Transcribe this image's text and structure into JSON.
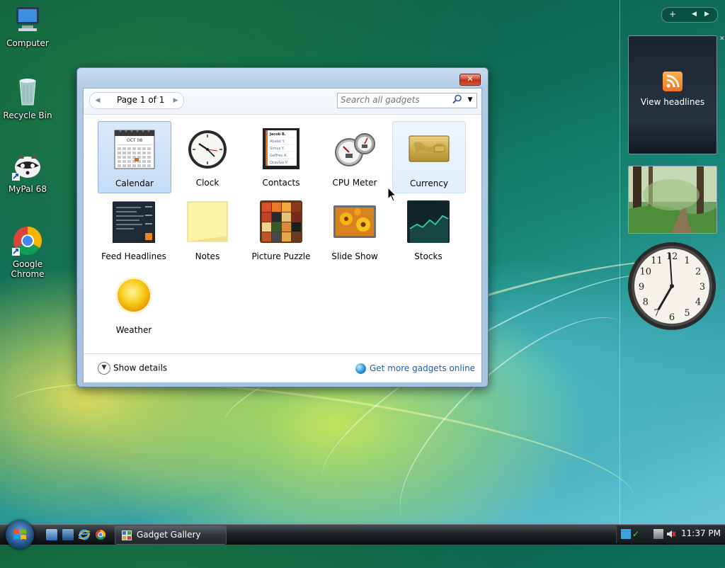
{
  "desktop": {
    "icons": [
      {
        "label": "Computer",
        "icon": "computer-icon"
      },
      {
        "label": "Recycle Bin",
        "icon": "recycle-bin-icon"
      },
      {
        "label": "MyPal 68",
        "icon": "mypal-icon"
      },
      {
        "label": "Google Chrome",
        "icon": "chrome-icon"
      }
    ]
  },
  "gallery": {
    "close_label": "✕",
    "pager_label": "Page 1 of 1",
    "search_placeholder": "Search all gadgets",
    "gadgets": [
      {
        "name": "Calendar",
        "icon": "calendar-icon",
        "state": "selected",
        "calendar_month": "OCT 08"
      },
      {
        "name": "Clock",
        "icon": "clock-icon",
        "state": "normal"
      },
      {
        "name": "Contacts",
        "icon": "contacts-icon",
        "state": "normal",
        "contact_names": [
          "Jacob B.",
          "Abalat Y.",
          "Simus Y.",
          "Geffrey A.",
          "Ocaviva V."
        ]
      },
      {
        "name": "CPU Meter",
        "icon": "cpu-meter-icon",
        "state": "normal"
      },
      {
        "name": "Currency",
        "icon": "currency-icon",
        "state": "hover"
      },
      {
        "name": "Feed Headlines",
        "icon": "feed-headlines-icon",
        "state": "normal"
      },
      {
        "name": "Notes",
        "icon": "notes-icon",
        "state": "normal"
      },
      {
        "name": "Picture Puzzle",
        "icon": "picture-puzzle-icon",
        "state": "normal"
      },
      {
        "name": "Slide Show",
        "icon": "slide-show-icon",
        "state": "normal"
      },
      {
        "name": "Stocks",
        "icon": "stocks-icon",
        "state": "normal"
      },
      {
        "name": "Weather",
        "icon": "weather-icon",
        "state": "normal"
      }
    ],
    "show_details_label": "Show details",
    "get_more_label": "Get more gadgets online"
  },
  "sidebar": {
    "add_label": "+",
    "feed_label": "View headlines"
  },
  "taskbar": {
    "task_label": "Gadget Gallery",
    "time": "11:37 PM"
  },
  "colors": {
    "link": "#1a5fb4",
    "selection": "#c3dcf5",
    "window_frame": "#aac4e0"
  }
}
